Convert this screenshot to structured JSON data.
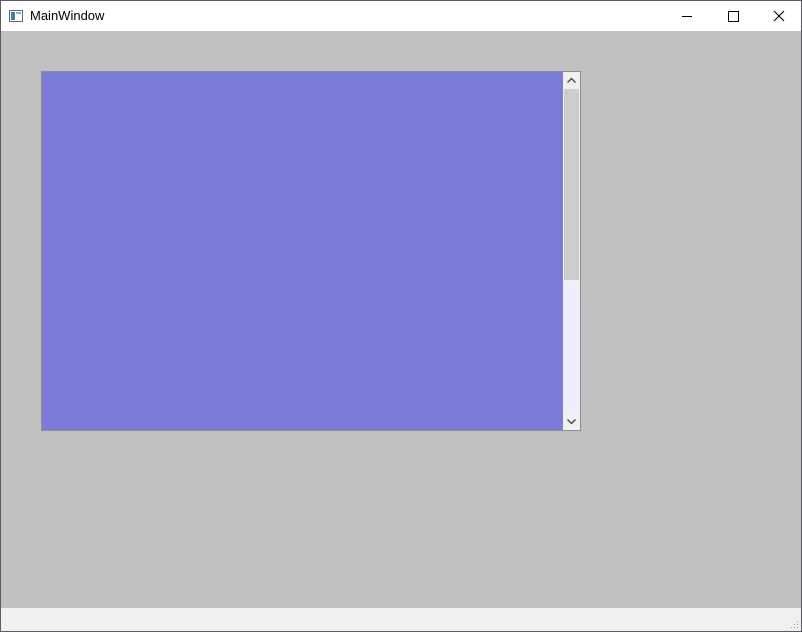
{
  "window": {
    "title": "MainWindow",
    "icon": "window-app-icon",
    "controls": {
      "minimize_icon": "minimize-icon",
      "maximize_icon": "maximize-icon",
      "close_icon": "close-icon"
    }
  },
  "content": {
    "background_color": "#c0c0c0",
    "scroll_area": {
      "viewport_color": "#7b7bd8",
      "scrollbar": {
        "orientation": "vertical",
        "up_icon": "chevron-up-icon",
        "down_icon": "chevron-down-icon",
        "thumb_fraction": 0.59,
        "scroll_position": 0.0
      }
    }
  },
  "status_bar": {
    "grip_icon": "resize-grip-icon"
  }
}
